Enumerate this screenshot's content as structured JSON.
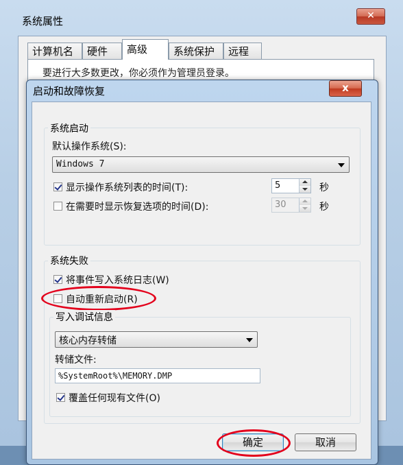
{
  "outer": {
    "title": "系统属性",
    "close_glyph": "✕",
    "tabs": [
      "计算机名",
      "硬件",
      "高级",
      "系统保护",
      "远程"
    ],
    "notice": "要进行大多数更改，你必须作为管理员登录。"
  },
  "dialog": {
    "title": "启动和故障恢复",
    "close_glyph": "x",
    "startup": {
      "group_label": "系统启动",
      "default_os_label": "默认操作系统(S):",
      "default_os_value": "Windows 7",
      "show_list_label": "显示操作系统列表的时间(T):",
      "show_list_checked": true,
      "show_list_value": "5",
      "show_recovery_label": "在需要时显示恢复选项的时间(D):",
      "show_recovery_checked": false,
      "show_recovery_value": "30",
      "seconds_unit": "秒"
    },
    "failure": {
      "group_label": "系统失败",
      "write_log_label": "将事件写入系统日志(W)",
      "write_log_checked": true,
      "auto_restart_label": "自动重新启动(R)",
      "auto_restart_checked": false,
      "debug_group_label": "写入调试信息",
      "debug_type_value": "核心内存转储",
      "dump_file_label": "转储文件:",
      "dump_file_value": "%SystemRoot%\\MEMORY.DMP",
      "overwrite_label": "覆盖任何现有文件(O)",
      "overwrite_checked": true
    },
    "buttons": {
      "ok": "确定",
      "cancel": "取消"
    }
  },
  "colors": {
    "annotation_red": "#e3001b",
    "check_mark": "#23348a"
  }
}
